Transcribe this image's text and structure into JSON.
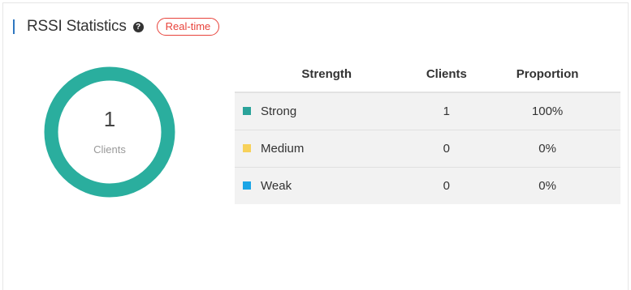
{
  "header": {
    "title": "RSSI Statistics",
    "help_icon": "?",
    "badge": "Real-time"
  },
  "donut": {
    "count": "1",
    "label": "Clients",
    "ring_color": "#2aae9e"
  },
  "table": {
    "columns": [
      "Strength",
      "Clients",
      "Proportion"
    ],
    "rows": [
      {
        "strength": "Strong",
        "clients": "1",
        "proportion": "100%",
        "color": "#2aa39a"
      },
      {
        "strength": "Medium",
        "clients": "0",
        "proportion": "0%",
        "color": "#f7d15a"
      },
      {
        "strength": "Weak",
        "clients": "0",
        "proportion": "0%",
        "color": "#1ba5e6"
      }
    ]
  }
}
